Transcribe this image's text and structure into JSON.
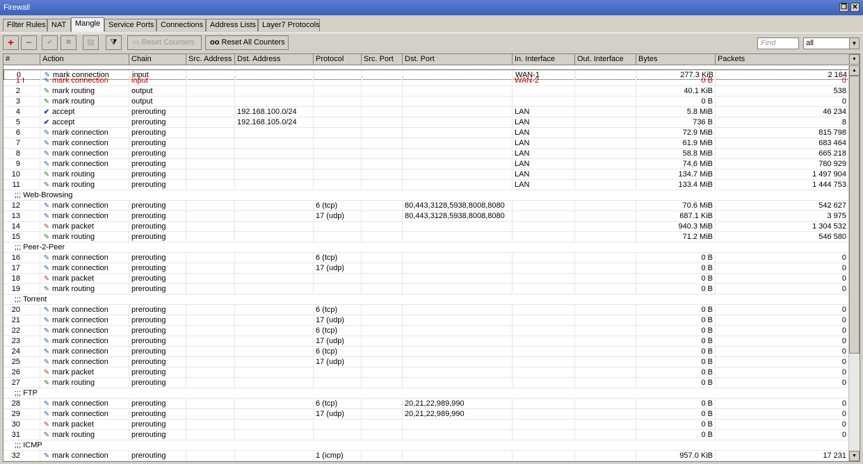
{
  "window": {
    "title": "Firewall"
  },
  "tabs": [
    "Filter Rules",
    "NAT",
    "Mangle",
    "Service Ports",
    "Connections",
    "Address Lists",
    "Layer7 Protocols"
  ],
  "active_tab": "Mangle",
  "toolbar": {
    "reset_counters": "Reset Counters",
    "reset_all_counters": "Reset All Counters",
    "find_placeholder": "Find",
    "filter_value": "all"
  },
  "columns": [
    "#",
    "Action",
    "Chain",
    "Src. Address",
    "Dst. Address",
    "Protocol",
    "Src. Port",
    "Dst. Port",
    "In. Interface",
    "Out. Interface",
    "Bytes",
    "Packets"
  ],
  "rows": [
    {
      "kind": "rule",
      "num": "0",
      "flag": "",
      "action": "mark connection",
      "icon": "conn",
      "chain": "input",
      "src": "",
      "dst": "",
      "proto": "",
      "sport": "",
      "dport": "",
      "iniface": "WAN-1",
      "outiface": "",
      "bytes": "277.3 KiB",
      "packets": "2 164"
    },
    {
      "kind": "rule",
      "num": "1",
      "flag": "I",
      "disabled": true,
      "action": "mark connection",
      "icon": "conn",
      "chain": "input",
      "src": "",
      "dst": "",
      "proto": "",
      "sport": "",
      "dport": "",
      "iniface": "WAN-2",
      "outiface": "",
      "bytes": "0 B",
      "packets": "0"
    },
    {
      "kind": "rule",
      "num": "2",
      "flag": "",
      "action": "mark routing",
      "icon": "route",
      "chain": "output",
      "src": "",
      "dst": "",
      "proto": "",
      "sport": "",
      "dport": "",
      "iniface": "",
      "outiface": "",
      "bytes": "40.1 KiB",
      "packets": "538"
    },
    {
      "kind": "rule",
      "num": "3",
      "flag": "",
      "action": "mark routing",
      "icon": "route",
      "chain": "output",
      "src": "",
      "dst": "",
      "proto": "",
      "sport": "",
      "dport": "",
      "iniface": "",
      "outiface": "",
      "bytes": "0 B",
      "packets": "0"
    },
    {
      "kind": "rule",
      "num": "4",
      "flag": "",
      "action": "accept",
      "icon": "accept",
      "chain": "prerouting",
      "src": "",
      "dst": "192.168.100.0/24",
      "proto": "",
      "sport": "",
      "dport": "",
      "iniface": "LAN",
      "outiface": "",
      "bytes": "5.8 MiB",
      "packets": "46 234"
    },
    {
      "kind": "rule",
      "num": "5",
      "flag": "",
      "action": "accept",
      "icon": "accept",
      "chain": "prerouting",
      "src": "",
      "dst": "192.168.105.0/24",
      "proto": "",
      "sport": "",
      "dport": "",
      "iniface": "LAN",
      "outiface": "",
      "bytes": "736 B",
      "packets": "8"
    },
    {
      "kind": "rule",
      "num": "6",
      "flag": "",
      "action": "mark connection",
      "icon": "conn",
      "chain": "prerouting",
      "src": "",
      "dst": "",
      "proto": "",
      "sport": "",
      "dport": "",
      "iniface": "LAN",
      "outiface": "",
      "bytes": "72.9 MiB",
      "packets": "815 798"
    },
    {
      "kind": "rule",
      "num": "7",
      "flag": "",
      "action": "mark connection",
      "icon": "conn",
      "chain": "prerouting",
      "src": "",
      "dst": "",
      "proto": "",
      "sport": "",
      "dport": "",
      "iniface": "LAN",
      "outiface": "",
      "bytes": "61.9 MiB",
      "packets": "683 464"
    },
    {
      "kind": "rule",
      "num": "8",
      "flag": "",
      "action": "mark connection",
      "icon": "conn",
      "chain": "prerouting",
      "src": "",
      "dst": "",
      "proto": "",
      "sport": "",
      "dport": "",
      "iniface": "LAN",
      "outiface": "",
      "bytes": "58.8 MiB",
      "packets": "665 218"
    },
    {
      "kind": "rule",
      "num": "9",
      "flag": "",
      "action": "mark connection",
      "icon": "conn",
      "chain": "prerouting",
      "src": "",
      "dst": "",
      "proto": "",
      "sport": "",
      "dport": "",
      "iniface": "LAN",
      "outiface": "",
      "bytes": "74.6 MiB",
      "packets": "780 929"
    },
    {
      "kind": "rule",
      "num": "10",
      "flag": "",
      "action": "mark routing",
      "icon": "route",
      "chain": "prerouting",
      "src": "",
      "dst": "",
      "proto": "",
      "sport": "",
      "dport": "",
      "iniface": "LAN",
      "outiface": "",
      "bytes": "134.7 MiB",
      "packets": "1 497 904"
    },
    {
      "kind": "rule",
      "num": "11",
      "flag": "",
      "action": "mark routing",
      "icon": "route",
      "chain": "prerouting",
      "src": "",
      "dst": "",
      "proto": "",
      "sport": "",
      "dport": "",
      "iniface": "LAN",
      "outiface": "",
      "bytes": "133.4 MiB",
      "packets": "1 444 753"
    },
    {
      "kind": "comment",
      "text": ";;; Web-Browsing"
    },
    {
      "kind": "rule",
      "num": "12",
      "flag": "",
      "action": "mark connection",
      "icon": "conn",
      "chain": "prerouting",
      "src": "",
      "dst": "",
      "proto": "6 (tcp)",
      "sport": "",
      "dport": "80,443,3128,5938,8008,8080",
      "iniface": "",
      "outiface": "",
      "bytes": "70.6 MiB",
      "packets": "542 627"
    },
    {
      "kind": "rule",
      "num": "13",
      "flag": "",
      "action": "mark connection",
      "icon": "conn",
      "chain": "prerouting",
      "src": "",
      "dst": "",
      "proto": "17 (udp)",
      "sport": "",
      "dport": "80,443,3128,5938,8008,8080",
      "iniface": "",
      "outiface": "",
      "bytes": "687.1 KiB",
      "packets": "3 975"
    },
    {
      "kind": "rule",
      "num": "14",
      "flag": "",
      "action": "mark packet",
      "icon": "packet",
      "chain": "prerouting",
      "src": "",
      "dst": "",
      "proto": "",
      "sport": "",
      "dport": "",
      "iniface": "",
      "outiface": "",
      "bytes": "940.3 MiB",
      "packets": "1 304 532"
    },
    {
      "kind": "rule",
      "num": "15",
      "flag": "",
      "action": "mark routing",
      "icon": "route",
      "chain": "prerouting",
      "src": "",
      "dst": "",
      "proto": "",
      "sport": "",
      "dport": "",
      "iniface": "",
      "outiface": "",
      "bytes": "71.2 MiB",
      "packets": "546 580"
    },
    {
      "kind": "comment",
      "text": ";;; Peer-2-Peer"
    },
    {
      "kind": "rule",
      "num": "16",
      "flag": "",
      "action": "mark connection",
      "icon": "conn",
      "chain": "prerouting",
      "src": "",
      "dst": "",
      "proto": "6 (tcp)",
      "sport": "",
      "dport": "",
      "iniface": "",
      "outiface": "",
      "bytes": "0 B",
      "packets": "0"
    },
    {
      "kind": "rule",
      "num": "17",
      "flag": "",
      "action": "mark connection",
      "icon": "conn",
      "chain": "prerouting",
      "src": "",
      "dst": "",
      "proto": "17 (udp)",
      "sport": "",
      "dport": "",
      "iniface": "",
      "outiface": "",
      "bytes": "0 B",
      "packets": "0"
    },
    {
      "kind": "rule",
      "num": "18",
      "flag": "",
      "action": "mark packet",
      "icon": "packet",
      "chain": "prerouting",
      "src": "",
      "dst": "",
      "proto": "",
      "sport": "",
      "dport": "",
      "iniface": "",
      "outiface": "",
      "bytes": "0 B",
      "packets": "0"
    },
    {
      "kind": "rule",
      "num": "19",
      "flag": "",
      "action": "mark routing",
      "icon": "route",
      "chain": "prerouting",
      "src": "",
      "dst": "",
      "proto": "",
      "sport": "",
      "dport": "",
      "iniface": "",
      "outiface": "",
      "bytes": "0 B",
      "packets": "0"
    },
    {
      "kind": "comment",
      "text": ";;; Torrent"
    },
    {
      "kind": "rule",
      "num": "20",
      "flag": "",
      "action": "mark connection",
      "icon": "conn",
      "chain": "prerouting",
      "src": "",
      "dst": "",
      "proto": "6 (tcp)",
      "sport": "",
      "dport": "",
      "iniface": "",
      "outiface": "",
      "bytes": "0 B",
      "packets": "0"
    },
    {
      "kind": "rule",
      "num": "21",
      "flag": "",
      "action": "mark connection",
      "icon": "conn",
      "chain": "prerouting",
      "src": "",
      "dst": "",
      "proto": "17 (udp)",
      "sport": "",
      "dport": "",
      "iniface": "",
      "outiface": "",
      "bytes": "0 B",
      "packets": "0"
    },
    {
      "kind": "rule",
      "num": "22",
      "flag": "",
      "action": "mark connection",
      "icon": "conn",
      "chain": "prerouting",
      "src": "",
      "dst": "",
      "proto": "6 (tcp)",
      "sport": "",
      "dport": "",
      "iniface": "",
      "outiface": "",
      "bytes": "0 B",
      "packets": "0"
    },
    {
      "kind": "rule",
      "num": "23",
      "flag": "",
      "action": "mark connection",
      "icon": "conn",
      "chain": "prerouting",
      "src": "",
      "dst": "",
      "proto": "17 (udp)",
      "sport": "",
      "dport": "",
      "iniface": "",
      "outiface": "",
      "bytes": "0 B",
      "packets": "0"
    },
    {
      "kind": "rule",
      "num": "24",
      "flag": "",
      "action": "mark connection",
      "icon": "conn",
      "chain": "prerouting",
      "src": "",
      "dst": "",
      "proto": "6 (tcp)",
      "sport": "",
      "dport": "",
      "iniface": "",
      "outiface": "",
      "bytes": "0 B",
      "packets": "0"
    },
    {
      "kind": "rule",
      "num": "25",
      "flag": "",
      "action": "mark connection",
      "icon": "conn",
      "chain": "prerouting",
      "src": "",
      "dst": "",
      "proto": "17 (udp)",
      "sport": "",
      "dport": "",
      "iniface": "",
      "outiface": "",
      "bytes": "0 B",
      "packets": "0"
    },
    {
      "kind": "rule",
      "num": "26",
      "flag": "",
      "action": "mark packet",
      "icon": "packet",
      "chain": "prerouting",
      "src": "",
      "dst": "",
      "proto": "",
      "sport": "",
      "dport": "",
      "iniface": "",
      "outiface": "",
      "bytes": "0 B",
      "packets": "0"
    },
    {
      "kind": "rule",
      "num": "27",
      "flag": "",
      "action": "mark routing",
      "icon": "route",
      "chain": "prerouting",
      "src": "",
      "dst": "",
      "proto": "",
      "sport": "",
      "dport": "",
      "iniface": "",
      "outiface": "",
      "bytes": "0 B",
      "packets": "0"
    },
    {
      "kind": "comment",
      "text": ";;; FTP"
    },
    {
      "kind": "rule",
      "num": "28",
      "flag": "",
      "action": "mark connection",
      "icon": "conn",
      "chain": "prerouting",
      "src": "",
      "dst": "",
      "proto": "6 (tcp)",
      "sport": "",
      "dport": "20,21,22,989,990",
      "iniface": "",
      "outiface": "",
      "bytes": "0 B",
      "packets": "0"
    },
    {
      "kind": "rule",
      "num": "29",
      "flag": "",
      "action": "mark connection",
      "icon": "conn",
      "chain": "prerouting",
      "src": "",
      "dst": "",
      "proto": "17 (udp)",
      "sport": "",
      "dport": "20,21,22,989,990",
      "iniface": "",
      "outiface": "",
      "bytes": "0 B",
      "packets": "0"
    },
    {
      "kind": "rule",
      "num": "30",
      "flag": "",
      "action": "mark packet",
      "icon": "packet",
      "chain": "prerouting",
      "src": "",
      "dst": "",
      "proto": "",
      "sport": "",
      "dport": "",
      "iniface": "",
      "outiface": "",
      "bytes": "0 B",
      "packets": "0"
    },
    {
      "kind": "rule",
      "num": "31",
      "flag": "",
      "action": "mark routing",
      "icon": "route",
      "chain": "prerouting",
      "src": "",
      "dst": "",
      "proto": "",
      "sport": "",
      "dport": "",
      "iniface": "",
      "outiface": "",
      "bytes": "0 B",
      "packets": "0"
    },
    {
      "kind": "comment",
      "text": ";;; ICMP"
    },
    {
      "kind": "rule",
      "num": "32",
      "flag": "",
      "action": "mark connection",
      "icon": "conn",
      "chain": "prerouting",
      "src": "",
      "dst": "",
      "proto": "1 (icmp)",
      "sport": "",
      "dport": "",
      "iniface": "",
      "outiface": "",
      "bytes": "957.0 KiB",
      "packets": "17 231"
    }
  ]
}
